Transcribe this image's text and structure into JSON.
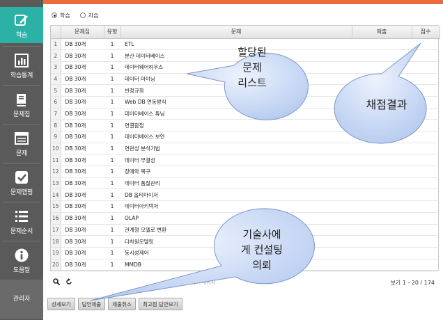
{
  "sidebar": {
    "items": [
      {
        "label": "학습",
        "icon": "edit-icon"
      },
      {
        "label": "학습통계",
        "icon": "bar-chart-icon"
      },
      {
        "label": "문제집",
        "icon": "book-icon"
      },
      {
        "label": "문제",
        "icon": "list-window-icon"
      },
      {
        "label": "문제맵핑",
        "icon": "checkbox-icon"
      },
      {
        "label": "문제순서",
        "icon": "list-icon"
      },
      {
        "label": "도움말",
        "icon": "info-icon"
      }
    ],
    "admin_label": "관리자"
  },
  "mode": {
    "options": [
      "학습",
      "자습"
    ],
    "selected": "학습"
  },
  "grid": {
    "headers": [
      "",
      "문제집",
      "유형",
      "문제",
      "제출",
      "점수"
    ],
    "rows": [
      {
        "n": "1",
        "set": "DB 30개",
        "type": "1",
        "q": "ETL"
      },
      {
        "n": "2",
        "set": "DB 30개",
        "type": "1",
        "q": "분산 데이터베이스"
      },
      {
        "n": "3",
        "set": "DB 30개",
        "type": "1",
        "q": "데이터웨어하우스"
      },
      {
        "n": "4",
        "set": "DB 30개",
        "type": "1",
        "q": "데이터 마이닝"
      },
      {
        "n": "5",
        "set": "DB 30개",
        "type": "1",
        "q": "반정규화"
      },
      {
        "n": "6",
        "set": "DB 30개",
        "type": "1",
        "q": "Web DB 연동방식"
      },
      {
        "n": "7",
        "set": "DB 30개",
        "type": "1",
        "q": "데이터베이스 튜닝"
      },
      {
        "n": "8",
        "set": "DB 30개",
        "type": "1",
        "q": "연결함정"
      },
      {
        "n": "9",
        "set": "DB 30개",
        "type": "1",
        "q": "데이터베이스 보안"
      },
      {
        "n": "10",
        "set": "DB 30개",
        "type": "1",
        "q": "연관성 분석기법"
      },
      {
        "n": "11",
        "set": "DB 30개",
        "type": "1",
        "q": "데이터 무결성"
      },
      {
        "n": "12",
        "set": "DB 30개",
        "type": "1",
        "q": "장애와 복구"
      },
      {
        "n": "13",
        "set": "DB 30개",
        "type": "1",
        "q": "데이터 품질관리"
      },
      {
        "n": "14",
        "set": "DB 30개",
        "type": "1",
        "q": "DB 옵티마이저"
      },
      {
        "n": "15",
        "set": "DB 30개",
        "type": "1",
        "q": "데이터아키텍처"
      },
      {
        "n": "16",
        "set": "DB 30개",
        "type": "1",
        "q": "OLAP"
      },
      {
        "n": "17",
        "set": "DB 30개",
        "type": "1",
        "q": "관계형 모델로 변환"
      },
      {
        "n": "18",
        "set": "DB 30개",
        "type": "1",
        "q": "다차원모델링"
      },
      {
        "n": "19",
        "set": "DB 30개",
        "type": "1",
        "q": "동시성제어"
      },
      {
        "n": "20",
        "set": "DB 30개",
        "type": "1",
        "q": "MMDB"
      }
    ]
  },
  "footer": {
    "pager_text": "페이지",
    "count_text": "보기 1 - 20 / 174"
  },
  "buttons": [
    "상세보기",
    "답안제출",
    "제출취소",
    "최고점 답안보기"
  ],
  "callouts": {
    "assigned": [
      "할당된",
      "문제",
      "리스트"
    ],
    "grading": [
      "채점결과"
    ],
    "consult": [
      "기술사에",
      "게 컨설팅",
      "의뢰"
    ]
  },
  "colors": {
    "sidebar_bg": "#5a5a5a",
    "sidebar_active": "#2bb1a5",
    "top_accent": "#ef6a3a",
    "callout_fill": "#c9d9f5"
  }
}
